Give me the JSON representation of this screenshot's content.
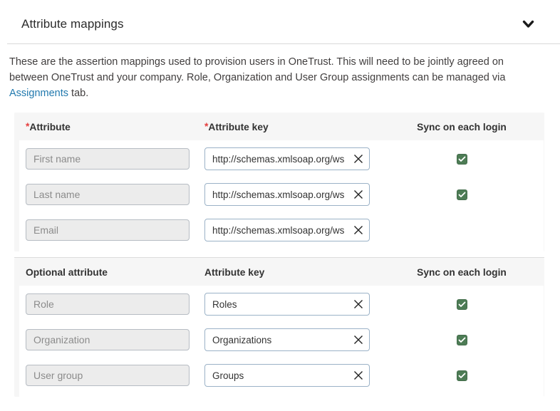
{
  "header": {
    "title": "Attribute mappings",
    "chevron_icon": "chevron-down",
    "accent_link_color": "#2179ae",
    "checkbox_color": "#4d7c55",
    "required_marker_color": "#e53e3e"
  },
  "description": {
    "text_before_link": "These are the assertion mappings used to provision users in OneTrust. This will need to be jointly agreed on between OneTrust and your company. Role, Organization and User Group assignments can be managed via ",
    "link_text": "Assignments",
    "text_after_link": " tab."
  },
  "required_section": {
    "required_marker": "*",
    "headers": {
      "attribute": "Attribute",
      "attribute_key": "Attribute key",
      "sync": "Sync on each login"
    },
    "rows": [
      {
        "attribute": "First name",
        "key": "http://schemas.xmlsoap.org/ws",
        "sync_visible": true,
        "sync_checked": true
      },
      {
        "attribute": "Last name",
        "key": "http://schemas.xmlsoap.org/ws",
        "sync_visible": true,
        "sync_checked": true
      },
      {
        "attribute": "Email",
        "key": "http://schemas.xmlsoap.org/ws",
        "sync_visible": false,
        "sync_checked": false
      }
    ]
  },
  "optional_section": {
    "headers": {
      "attribute": "Optional attribute",
      "attribute_key": "Attribute key",
      "sync": "Sync on each login"
    },
    "rows": [
      {
        "attribute": "Role",
        "key": "Roles",
        "sync_visible": true,
        "sync_checked": true
      },
      {
        "attribute": "Organization",
        "key": "Organizations",
        "sync_visible": true,
        "sync_checked": true
      },
      {
        "attribute": "User group",
        "key": "Groups",
        "sync_visible": true,
        "sync_checked": true
      }
    ]
  }
}
